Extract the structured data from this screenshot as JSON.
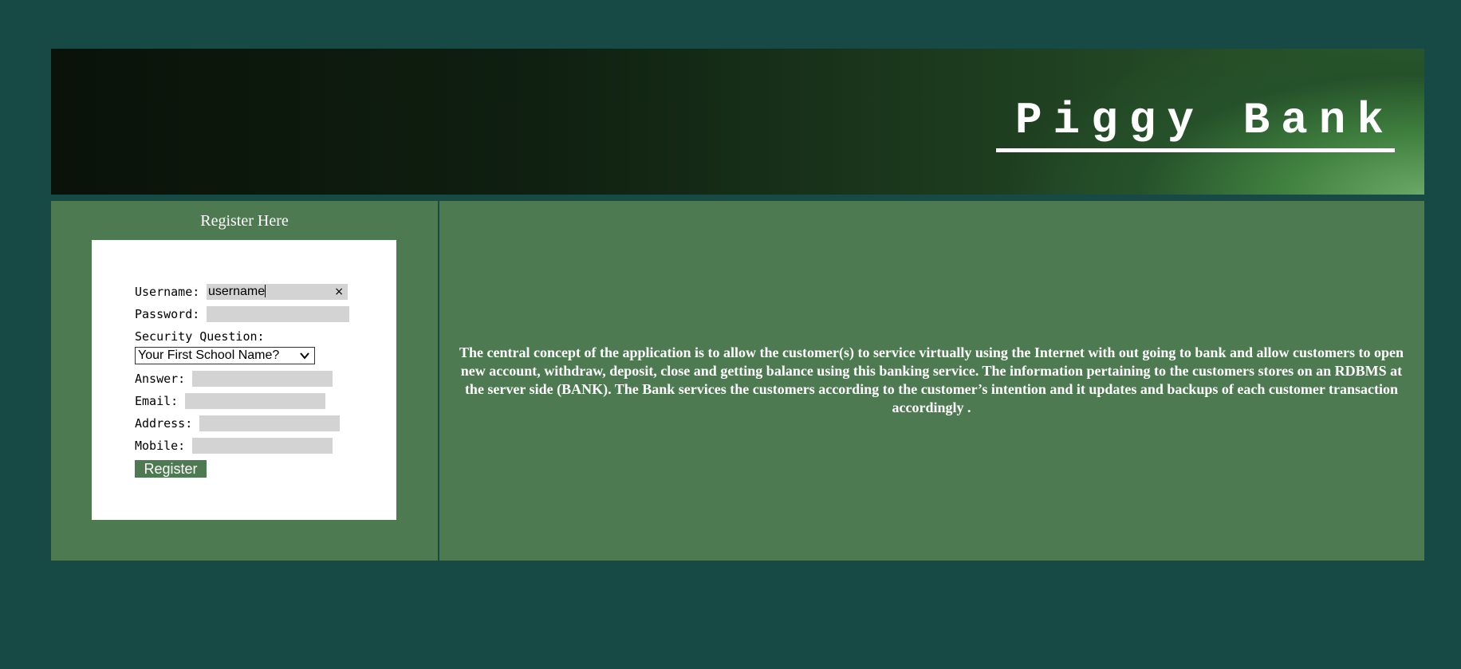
{
  "header": {
    "title": "Piggy Bank"
  },
  "register": {
    "heading": "Register Here",
    "fields": {
      "username": {
        "label": "Username:",
        "value": "username"
      },
      "password": {
        "label": "Password:",
        "value": ""
      },
      "security_question": {
        "label": "Security Question:",
        "selected": "Your First School Name?"
      },
      "answer": {
        "label": "Answer:",
        "value": ""
      },
      "email": {
        "label": "Email:",
        "value": ""
      },
      "address": {
        "label": "Address:",
        "value": ""
      },
      "mobile": {
        "label": "Mobile:",
        "value": ""
      }
    },
    "clear_glyph": "×",
    "submit_label": "Register"
  },
  "description": {
    "text": "The central concept of the application is to allow the customer(s) to service virtually using the Internet with out going to bank and allow customers to open new account, withdraw, deposit, close and getting balance using this banking service.  The information pertaining to the customers stores on an RDBMS at the server side (BANK).  The Bank services the customers according to the customer’s intention and it updates and backups of each customer transaction accordingly ."
  },
  "colors": {
    "page_background": "#174a44",
    "panel_background": "#4e7a52",
    "input_background": "#d3d3d3",
    "button_background": "#4e7a52",
    "text_light": "#ffffff"
  }
}
